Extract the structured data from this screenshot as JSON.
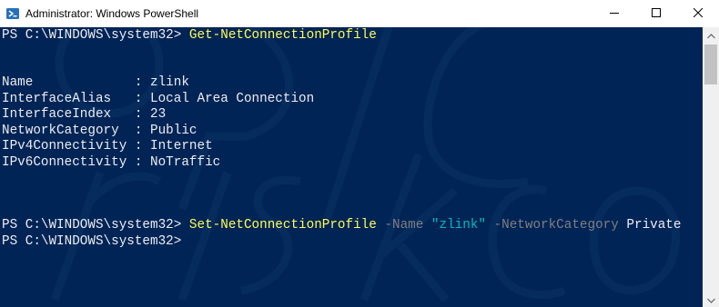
{
  "window": {
    "title": "Administrator: Windows PowerShell",
    "icon": "powershell-icon",
    "controls": {
      "minimize": "minimize-icon",
      "maximize": "maximize-icon",
      "close": "close-icon"
    }
  },
  "colors": {
    "console_background": "#012456",
    "console_text": "#eeedf0",
    "command": "#fdfd56",
    "parameter": "#7f7f7f",
    "string": "#00bcbc"
  },
  "console": {
    "line1": {
      "prompt": "PS C:\\WINDOWS\\system32> ",
      "command": "Get-NetConnectionProfile"
    },
    "profile": [
      {
        "text": "Name             : zlink"
      },
      {
        "text": "InterfaceAlias   : Local Area Connection"
      },
      {
        "text": "InterfaceIndex   : 23"
      },
      {
        "text": "NetworkCategory  : Public"
      },
      {
        "text": "IPv4Connectivity : Internet"
      },
      {
        "text": "IPv6Connectivity : NoTraffic"
      }
    ],
    "line2": {
      "prompt": "PS C:\\WINDOWS\\system32> ",
      "command": "Set-NetConnectionProfile",
      "param1": " -Name ",
      "value1": "\"zlink\"",
      "param2": " -NetworkCategory ",
      "value2": "Private"
    },
    "line3": {
      "prompt": "PS C:\\WINDOWS\\system32>"
    }
  }
}
